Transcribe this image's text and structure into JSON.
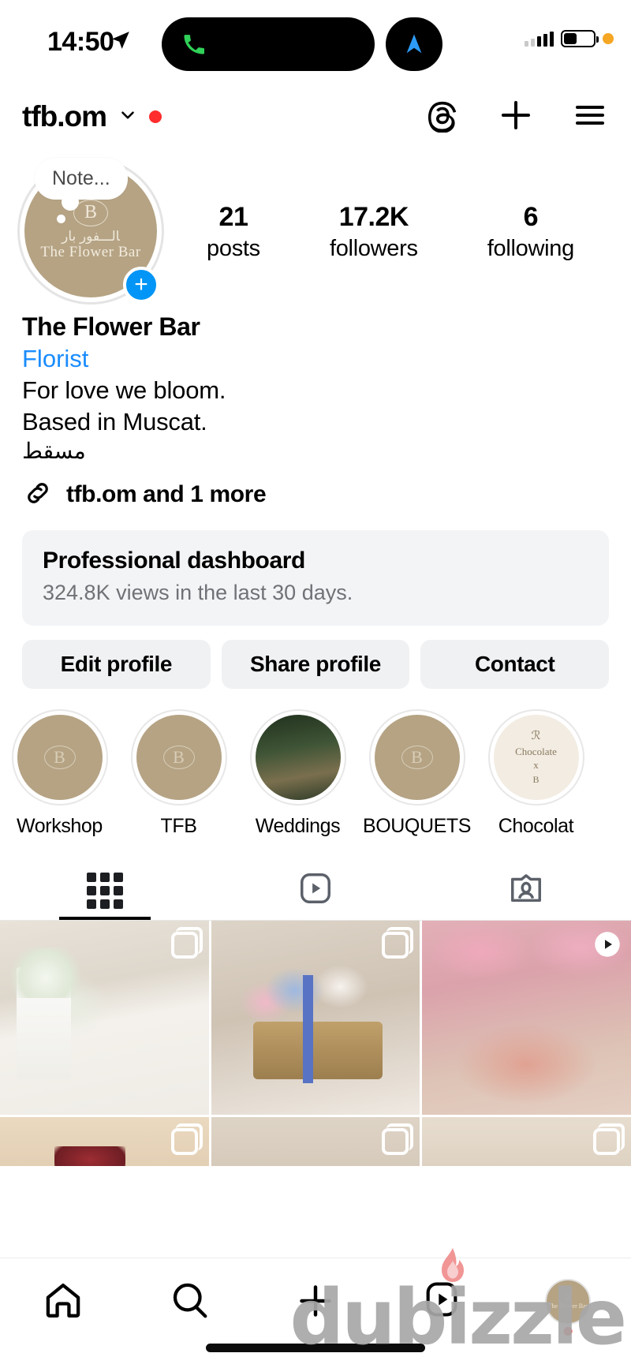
{
  "status_bar": {
    "time": "14:50",
    "location_icon": "location-arrow-icon",
    "call_icon": "phone-call-icon",
    "nav_icon": "navigation-arrow-icon",
    "signal_icon": "signal-bars-icon",
    "battery_icon": "battery-icon",
    "privacy_dot": "orange-privacy-dot"
  },
  "header": {
    "username": "tfb.om",
    "chevron": "chevron-down-icon",
    "unread_dot": "red-dot",
    "threads_icon": "threads-icon",
    "add_icon": "plus-icon",
    "menu_icon": "hamburger-menu-icon"
  },
  "profile": {
    "note": "Note...",
    "avatar_monogram": "B",
    "avatar_arabic": "ﺎﻟـــﻔﻮﺭ ﺑﺎﺭ",
    "avatar_name": "The Flower Bar",
    "add_story": "+",
    "stats": [
      {
        "num": "21",
        "label": "posts"
      },
      {
        "num": "17.2K",
        "label": "followers"
      },
      {
        "num": "6",
        "label": "following"
      }
    ],
    "display_name": "The Flower Bar",
    "category": "Florist",
    "bio_lines": [
      "For love we bloom.",
      "Based in Muscat."
    ],
    "bio_arabic": "مسقط",
    "link_icon": "link-chain-icon",
    "link_text": "tfb.om and 1 more"
  },
  "dashboard": {
    "title": "Professional dashboard",
    "subtitle": "324.8K views in the last 30 days."
  },
  "actions": [
    {
      "label": "Edit profile",
      "name": "edit-profile-button"
    },
    {
      "label": "Share profile",
      "name": "share-profile-button"
    },
    {
      "label": "Contact",
      "name": "contact-button"
    }
  ],
  "highlights": [
    {
      "label": "Workshop",
      "style": "logo"
    },
    {
      "label": "TFB",
      "style": "logo"
    },
    {
      "label": "Weddings",
      "style": "photo"
    },
    {
      "label": "BOUQUETS",
      "style": "logo"
    },
    {
      "label": "Chocolat",
      "style": "chocolate"
    }
  ],
  "tabs": [
    {
      "name": "tab-grid",
      "icon": "grid-icon",
      "active": true
    },
    {
      "name": "tab-reels",
      "icon": "reels-icon",
      "active": false
    },
    {
      "name": "tab-tagged",
      "icon": "tagged-icon",
      "active": false
    }
  ],
  "posts": [
    {
      "badge": "carousel-icon",
      "cls": "p1"
    },
    {
      "badge": "carousel-icon",
      "cls": "p2"
    },
    {
      "badge": "reel-icon",
      "cls": "p3"
    },
    {
      "badge": "carousel-icon",
      "cls": "p4"
    },
    {
      "badge": "carousel-icon",
      "cls": "p5"
    },
    {
      "badge": "carousel-icon",
      "cls": "p6"
    }
  ],
  "bottom_nav": [
    {
      "name": "nav-home",
      "icon": "home-icon"
    },
    {
      "name": "nav-search",
      "icon": "search-icon"
    },
    {
      "name": "nav-create",
      "icon": "plus-icon"
    },
    {
      "name": "nav-reels",
      "icon": "reels-icon"
    },
    {
      "name": "nav-profile",
      "icon": "profile-avatar-icon"
    }
  ],
  "watermark": {
    "text": "dubizzle"
  },
  "colors": {
    "accent_blue": "#0095f6",
    "link_blue": "#1a8cff",
    "brand_tan": "#b5a384",
    "notice_red": "#ff2d2d",
    "card_gray": "#f3f4f6"
  }
}
